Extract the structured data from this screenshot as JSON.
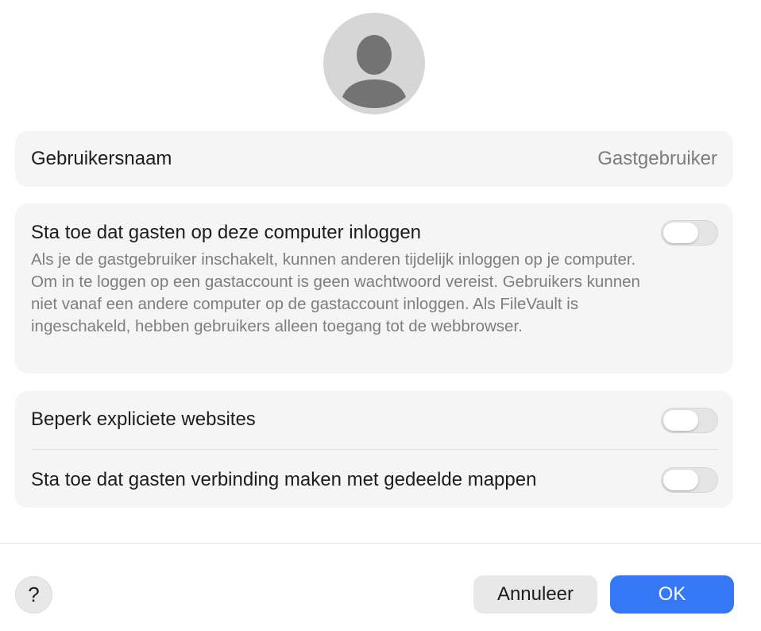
{
  "avatar": {
    "icon": "person-silhouette-icon"
  },
  "username_row": {
    "label": "Gebruikersnaam",
    "value": "Gastgebruiker"
  },
  "guest_login": {
    "label": "Sta toe dat gasten op deze computer inloggen",
    "description": "Als je de gastgebruiker inschakelt, kunnen anderen tijdelijk inloggen op je computer. Om in te loggen op een gastaccount is geen wachtwoord vereist. Gebruikers kunnen niet vanaf een andere computer op de gastaccount inloggen. Als FileVault is ingeschakeld, hebben gebruikers alleen toegang tot de webbrowser.",
    "enabled": false
  },
  "options": [
    {
      "label": "Beperk expliciete websites",
      "enabled": false
    },
    {
      "label": "Sta toe dat gasten verbinding maken met gedeelde mappen",
      "enabled": false
    }
  ],
  "footer": {
    "help_label": "?",
    "cancel_label": "Annuleer",
    "ok_label": "OK"
  },
  "colors": {
    "accent": "#3478f6",
    "group_bg": "#f5f5f5",
    "secondary_text": "#7c7c7c"
  }
}
